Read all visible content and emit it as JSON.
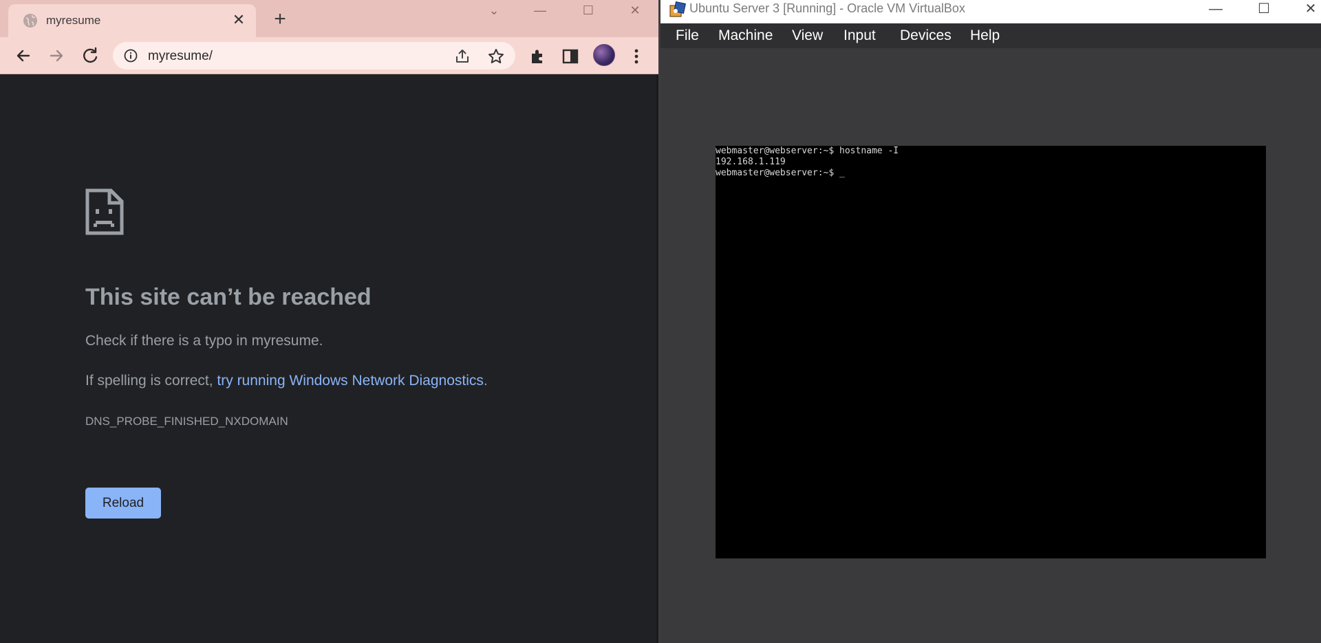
{
  "browser": {
    "tab_title": "myresume",
    "url": "myresume/",
    "colors": {
      "tab_strip": "#e9c1bc",
      "toolbar": "#f7d7d2",
      "page_bg": "#202124",
      "link": "#8ab4f8"
    },
    "error": {
      "title": "This site can’t be reached",
      "typo_msg": "Check if there is a typo in myresume.",
      "spell_prefix": "If spelling is correct, ",
      "diag_link": "try running Windows Network Diagnostics",
      "spell_suffix": ".",
      "code": "DNS_PROBE_FINISHED_NXDOMAIN",
      "reload_label": "Reload"
    }
  },
  "vbox": {
    "title": "Ubuntu Server 3 [Running] - Oracle VM VirtualBox",
    "menu": [
      "File",
      "Machine",
      "View",
      "Input",
      "Devices",
      "Help"
    ],
    "terminal": [
      "webmaster@webserver:~$ hostname -I",
      "192.168.1.119",
      "webmaster@webserver:~$ _"
    ]
  }
}
